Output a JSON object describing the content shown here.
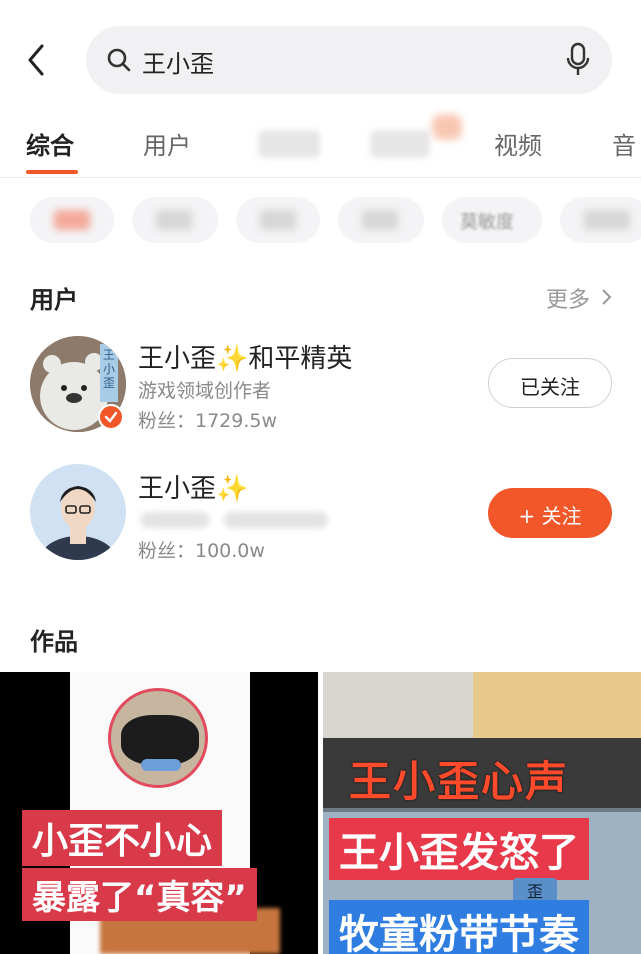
{
  "search": {
    "query": "王小歪"
  },
  "tabs": [
    "综合",
    "用户",
    "视频",
    "音"
  ],
  "users_section": {
    "title": "用户",
    "more": "更多"
  },
  "users": [
    {
      "name": "王小歪",
      "name_suffix": "和平精英",
      "sparkle": "✨",
      "subtitle": "游戏领域创作者",
      "fans": "粉丝：1729.5w",
      "button": "已关注",
      "avatar_text": "王小歪"
    },
    {
      "name": "王小歪",
      "sparkle": "✨",
      "fans": "粉丝：100.0w",
      "button": "+ 关注"
    }
  ],
  "chips": {
    "partial": "莫敏度"
  },
  "works_section": {
    "title": "作品"
  },
  "works": [
    {
      "caption_line1": "小歪不小心",
      "caption_line2": "暴露了“真容”"
    },
    {
      "caption_line1": "王小歪心声",
      "caption_line2": "王小歪发怒了",
      "caption_line3": "牧童粉带节奏",
      "badge": "歪"
    }
  ],
  "colors": {
    "accent": "#f2572a",
    "muted": "#8a8a8a",
    "bg_search": "#f1f1f3"
  }
}
